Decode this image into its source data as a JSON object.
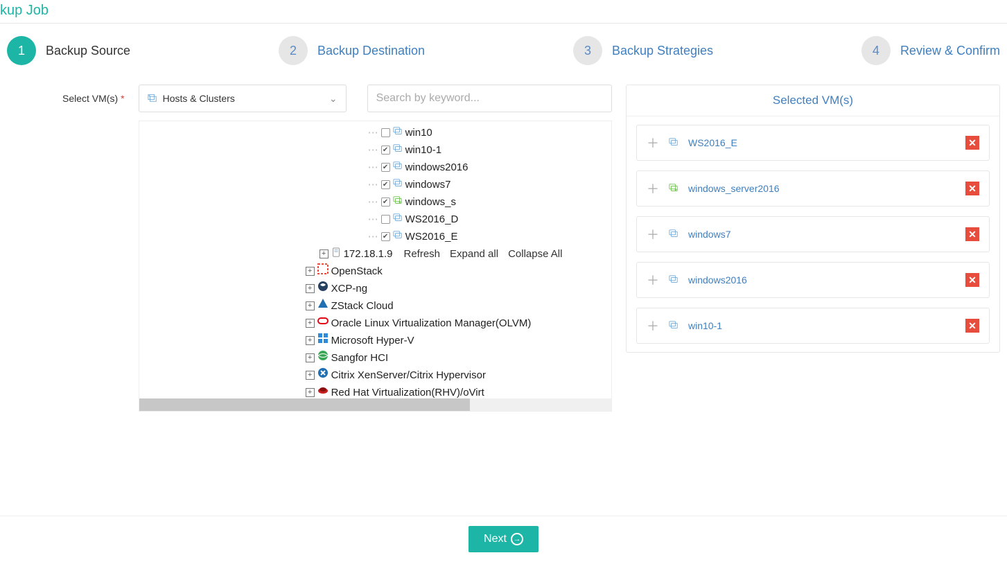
{
  "page_title_fragment": "kup Job",
  "wizard": {
    "steps": [
      {
        "num": "1",
        "label": "Backup Source",
        "active": true
      },
      {
        "num": "2",
        "label": "Backup Destination",
        "active": false
      },
      {
        "num": "3",
        "label": "Backup Strategies",
        "active": false
      },
      {
        "num": "4",
        "label": "Review & Confirm",
        "active": false
      }
    ]
  },
  "field_label": "Select VM(s)",
  "view_selector": "Hosts & Clusters",
  "search_placeholder": "Search by keyword...",
  "tree": {
    "vms": [
      {
        "name": "win10",
        "checked": false
      },
      {
        "name": "win10-1",
        "checked": true
      },
      {
        "name": "windows2016",
        "checked": true
      },
      {
        "name": "windows7",
        "checked": true
      },
      {
        "name": "windows_s",
        "checked": true,
        "running": true
      },
      {
        "name": "WS2016_D",
        "checked": false
      },
      {
        "name": "WS2016_E",
        "checked": true
      }
    ],
    "host": {
      "ip": "172.18.1.9",
      "actions": {
        "refresh": "Refresh",
        "expand": "Expand all",
        "collapse": "Collapse All"
      }
    },
    "providers": [
      {
        "name": "OpenStack",
        "icon": "openstack"
      },
      {
        "name": "XCP-ng",
        "icon": "xcpng"
      },
      {
        "name": "ZStack Cloud",
        "icon": "zstack"
      },
      {
        "name": "Oracle Linux Virtualization Manager(OLVM)",
        "icon": "oracle"
      },
      {
        "name": "Microsoft Hyper-V",
        "icon": "hyperv"
      },
      {
        "name": "Sangfor HCI",
        "icon": "sangfor"
      },
      {
        "name": "Citrix XenServer/Citrix Hypervisor",
        "icon": "citrix"
      },
      {
        "name": "Red Hat Virtualization(RHV)/oVirt",
        "icon": "redhat"
      }
    ]
  },
  "selected_panel": {
    "title": "Selected VM(s)",
    "items": [
      {
        "name": "WS2016_E"
      },
      {
        "name": "windows_server2016",
        "running": true
      },
      {
        "name": "windows7"
      },
      {
        "name": "windows2016"
      },
      {
        "name": "win10-1"
      }
    ]
  },
  "footer": {
    "next": "Next"
  }
}
